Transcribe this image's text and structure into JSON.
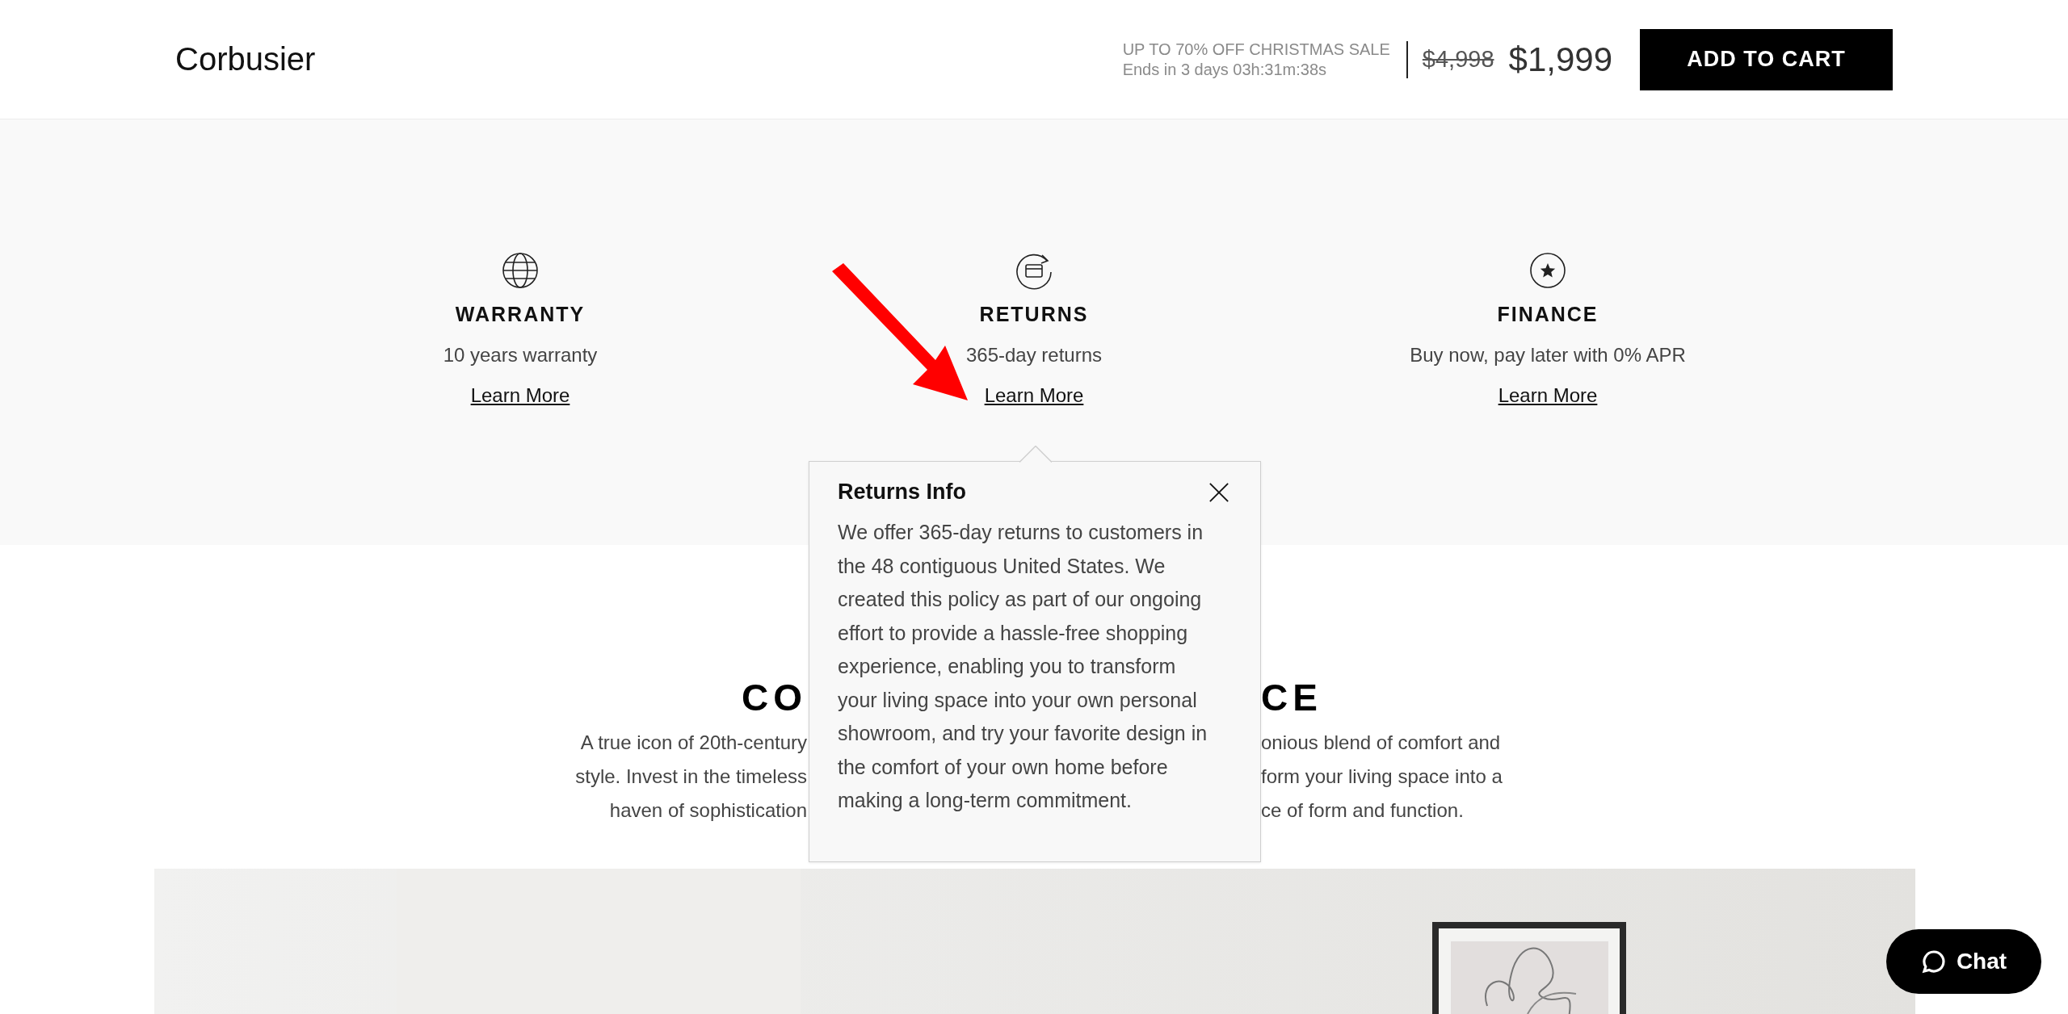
{
  "header": {
    "brand": "Corbusier",
    "sale_title": "UP TO 70% OFF CHRISTMAS SALE",
    "countdown": "Ends in 3 days 03h:31m:38s",
    "old_price": "$4,998",
    "price": "$1,999",
    "cta": "ADD TO CART"
  },
  "features": [
    {
      "kind": "globe",
      "title": "WARRANTY",
      "text": "10 years warranty",
      "link": "Learn More"
    },
    {
      "kind": "returns",
      "title": "RETURNS",
      "text": "365-day returns",
      "link": "Learn More"
    },
    {
      "kind": "star",
      "title": "FINANCE",
      "text": "Buy now, pay later with 0% APR",
      "link": "Learn More"
    }
  ],
  "collection": {
    "heading_left": "CO",
    "heading_right": "CE",
    "lines": [
      {
        "left": "A true icon of 20th-century",
        "right": "onious blend of comfort and"
      },
      {
        "left": "style. Invest in the timeless",
        "right": "form your living space into a"
      },
      {
        "left": "haven of sophistication",
        "right": "ce of form and function."
      }
    ]
  },
  "popover": {
    "title": "Returns Info",
    "body": "We offer 365-day returns to customers in the 48 contiguous United States. We created this policy as part of our ongoing effort to provide a hassle-free shopping experience, enabling you to transform your living space into your own personal showroom, and try your favorite design in the comfort of your own home before making a long-term commitment."
  },
  "chat": {
    "label": "Chat"
  }
}
